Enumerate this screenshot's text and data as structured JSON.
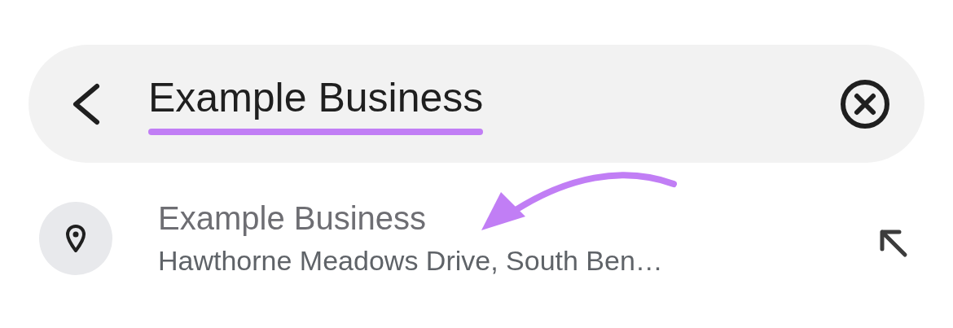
{
  "search": {
    "value": "Example Business",
    "underlined": true
  },
  "suggestions": [
    {
      "title": "Example Business",
      "subtitle": "Hawthorne Meadows Drive, South Ben…",
      "pointed_at": true
    }
  ]
}
